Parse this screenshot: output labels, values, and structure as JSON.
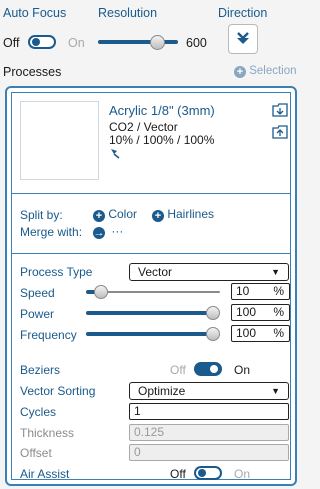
{
  "top": {
    "auto_focus_label": "Auto Focus",
    "resolution_label": "Resolution",
    "direction_label": "Direction",
    "auto_focus_off": "Off",
    "auto_focus_on": "On",
    "auto_focus_state": "off",
    "resolution_value": "600",
    "direction_icon": "arrow-down-icon"
  },
  "processes": {
    "label": "Processes",
    "selection_label": "Selection"
  },
  "material": {
    "name": "Acrylic 1/8\" (3mm)",
    "mode": "CO2 / Vector",
    "settings": "10% / 100% / 100%"
  },
  "split": {
    "split_label": "Split by:",
    "color_label": "Color",
    "hairlines_label": "Hairlines",
    "merge_label": "Merge with:",
    "merge_more": "···"
  },
  "process": {
    "type_label": "Process Type",
    "type_value": "Vector",
    "speed_label": "Speed",
    "speed_value": "10",
    "power_label": "Power",
    "power_value": "100",
    "frequency_label": "Frequency",
    "frequency_value": "100",
    "percent": "%",
    "beziers_label": "Beziers",
    "beziers_off": "Off",
    "beziers_on": "On",
    "beziers_state": "on",
    "sorting_label": "Vector Sorting",
    "sorting_value": "Optimize",
    "cycles_label": "Cycles",
    "cycles_value": "1",
    "thickness_label": "Thickness",
    "thickness_value": "0.125",
    "offset_label": "Offset",
    "offset_value": "0",
    "air_assist_label": "Air Assist",
    "air_off": "Off",
    "air_on": "On",
    "air_state": "off"
  },
  "colors": {
    "accent": "#1a5a8c",
    "border": "#3a7fb5"
  }
}
